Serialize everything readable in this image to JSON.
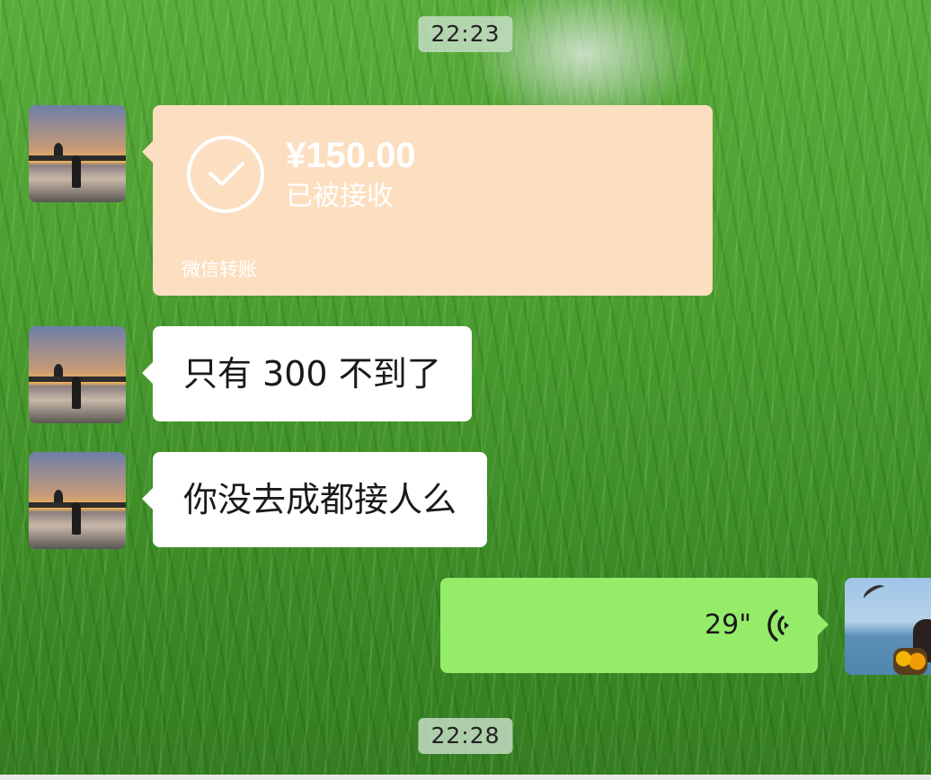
{
  "timestamps": {
    "top": "22:23",
    "bottom": "22:28"
  },
  "transfer": {
    "amount": "¥150.00",
    "status": "已被接收",
    "brand": "微信转账",
    "icon": "check-circle-icon"
  },
  "messages": [
    {
      "sender": "other",
      "text": "只有 300 不到了"
    },
    {
      "sender": "other",
      "text": "你没去成都接人么"
    }
  ],
  "voice": {
    "sender": "self",
    "duration": "29\"",
    "icon": "voice-wave-icon"
  },
  "colors": {
    "transfer_bubble": "#fcdfc0",
    "self_bubble": "#95ec69",
    "other_bubble": "#ffffff"
  }
}
